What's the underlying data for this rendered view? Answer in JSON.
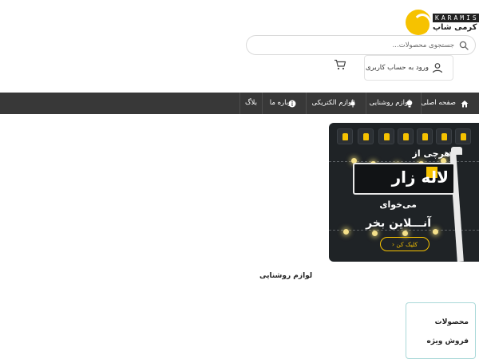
{
  "brand": {
    "latin": "KARAMIS",
    "farsi": "کرمی شاپ",
    "accent_color": "#f6c200"
  },
  "header": {
    "search_placeholder": "جستجوی محصولات...",
    "account_label": "ورود به حساب کاربری",
    "icons": [
      "search-icon",
      "user-icon",
      "cart-icon"
    ]
  },
  "nav": {
    "background": "#383838",
    "items": [
      {
        "label": "صفحه اصلی",
        "icon": "home-icon"
      },
      {
        "label": "لوازم روشنایی",
        "icon": "bulb-icon"
      },
      {
        "label": "لوازم الکتریکی",
        "icon": "plug-icon"
      },
      {
        "label": "درباره ما",
        "icon": "info-icon"
      },
      {
        "label": "بلاگ",
        "icon": ""
      }
    ]
  },
  "banner": {
    "line1": "هرچی از",
    "headline": "لاله زار",
    "line2": "می‌خوای",
    "line3": "آنـــلاین بخر",
    "button_label": "کلیک کن ‹"
  },
  "section": {
    "title": "لوازم روشنایی"
  },
  "special_box": {
    "text": "محصولات فروش ویژه"
  }
}
